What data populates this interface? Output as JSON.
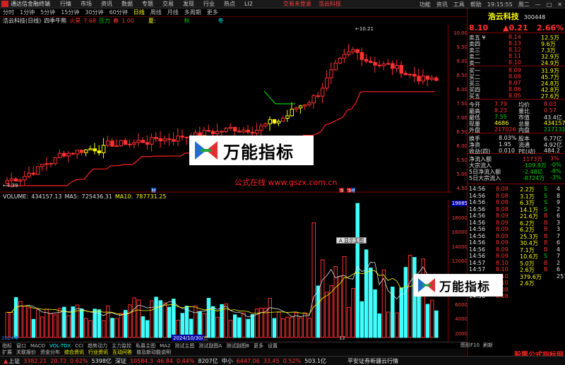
{
  "menubar": {
    "app": "通达信金融终端",
    "items": [
      "行情",
      "市场",
      "资讯",
      "数据",
      "专题",
      "交易",
      "发现",
      "行业",
      "热点",
      "LI2"
    ],
    "center1": "交易未登录",
    "center2": "浩云科技",
    "right": [
      "功能",
      "资讯",
      "工具",
      "帮助"
    ],
    "time": "19:15:55",
    "timeLabel": "周二"
  },
  "toolbar": {
    "items": [
      "分时",
      "1分钟",
      "5分钟",
      "15分钟",
      "30分钟",
      "60分钟",
      "日线",
      "周线",
      "月线",
      "多周期",
      "更多"
    ],
    "active": 6
  },
  "chart": {
    "header": {
      "stock": "浩云科技(日线)",
      "indicator": "四季牛熊",
      "l1": "夏:",
      "l1v": "秋",
      "cold": "冬",
      "hot": "火星",
      "hotv": "7.68",
      "press": "压力",
      "spring": "春",
      "springv": "1.00"
    },
    "yticks": [
      "10.00",
      "9.50",
      "9.00",
      "8.50",
      "8.00",
      "7.50",
      "7.00",
      "6.50",
      "6.00",
      "5.50",
      "5.00",
      "4.50"
    ],
    "hiLabel": "10.21",
    "loLabel": "4.39",
    "cai1": "财",
    "cai2": "财",
    "jin1": "净",
    "jin2": "净"
  },
  "volume": {
    "header": {
      "name": "VOLUME:",
      "vol": "434157.13",
      "ma5lbl": "MA5:",
      "ma5": "725436.31",
      "ma10lbl": "MA10:",
      "ma10": "787731.25"
    },
    "yticks": [
      "19885",
      "18000",
      "16000",
      "14000",
      "12000",
      "10000",
      "8000",
      "6000",
      "4000",
      "2000"
    ],
    "date1": "2024年",
    "date2": "2024/10/30/三",
    "date3": "12",
    "tooltip": "A 显示主图"
  },
  "chart_data": {
    "type": "bar",
    "title": "",
    "categories": [],
    "values": []
  },
  "bottomtabs": [
    "指标",
    "窗口",
    "MACD",
    "VOL-TDX",
    "CCI",
    "趋势动力",
    "主力监控",
    "私募主图",
    "MA2",
    "测试主图",
    "测试副图A",
    "测试副图B",
    "更多",
    "设置"
  ],
  "subtabs": [
    "扩展",
    "关联报价",
    "资金分布",
    "综合资讯",
    "行业资讯",
    "互动问答",
    "普及新动能说明"
  ],
  "rightpanel": {
    "name": "浩云科技",
    "code": "300448",
    "price": "8.10",
    "change": "▲0.21",
    "pct": "2.66%",
    "asks": [
      {
        "l": "卖五 ¥",
        "p": "8.14",
        "v": "12.5万"
      },
      {
        "l": "卖四",
        "p": "8.13",
        "v": "9.6万"
      },
      {
        "l": "卖三",
        "p": "8.12",
        "v": "7.3万"
      },
      {
        "l": "卖二",
        "p": "8.11",
        "v": "32.9万"
      },
      {
        "l": "卖一",
        "p": "8.10",
        "v": "24.9万"
      }
    ],
    "bids": [
      {
        "l": "买一",
        "p": "8.09",
        "v": "31.9万"
      },
      {
        "l": "买二",
        "p": "8.08",
        "v": "45.7万"
      },
      {
        "l": "买三",
        "p": "8.07",
        "v": "24.8万"
      },
      {
        "l": "买四",
        "p": "8.06",
        "v": "42.8万"
      },
      {
        "l": "买五",
        "p": "8.05",
        "v": "27.6万"
      }
    ],
    "stats": [
      [
        "今开",
        "7.79",
        "均价",
        "8.03"
      ],
      [
        "最高",
        "8.23",
        "量比",
        "0.57"
      ],
      [
        "最低",
        "7.55",
        "市值",
        "43.4亿"
      ],
      [
        "现量",
        "4686",
        "总量",
        "434157"
      ],
      [
        "外盘",
        "217026",
        "内盘",
        "217131"
      ]
    ],
    "stats2": [
      [
        "换手",
        "8.03%",
        "股本",
        "6.77亿"
      ],
      [
        "净资",
        "1.95",
        "流通",
        "4.92亿"
      ],
      [
        "收益(四)",
        "0.010",
        "PE(动)",
        "484.2"
      ]
    ],
    "flows": [
      [
        "净流入额",
        "1173万",
        "3%"
      ],
      [
        "大宗流入",
        "-109.8万",
        "-0%"
      ],
      [
        "5日净流入额",
        "-2.48亿",
        "-8%"
      ],
      [
        "5日大宗流入",
        "-8724万",
        "-3%"
      ]
    ],
    "ticks": [
      [
        "14:56",
        "8.08",
        "2.2万",
        "S",
        "4"
      ],
      [
        "14:56",
        "8.08",
        "3.1万",
        "S",
        "8"
      ],
      [
        "14:56",
        "8.08",
        "6.3万",
        "S",
        "9"
      ],
      [
        "14:56",
        "8.08",
        "14.1万",
        "S",
        "2"
      ],
      [
        "14:56",
        "8.09",
        "21.6万",
        "B",
        "6"
      ],
      [
        "14:56",
        "8.09",
        "6.2万",
        "B",
        "3"
      ],
      [
        "14:56",
        "8.09",
        "6.2万",
        "B",
        "3"
      ],
      [
        "14:56",
        "8.09",
        "25.3万",
        "B",
        "7"
      ],
      [
        "14:56",
        "8.09",
        "30.4万",
        "B",
        "6"
      ],
      [
        "14:56",
        "8.09",
        "7.1万",
        "B",
        "4"
      ],
      [
        "14:56",
        "8.09",
        "10.6万",
        "S",
        "7"
      ],
      [
        "14:57",
        "8.10",
        "5.0万",
        "B",
        "2"
      ],
      [
        "14:57",
        "8.10",
        "2.6万",
        "B",
        "6"
      ],
      [
        "15:00",
        "8.10",
        "379.6万",
        "",
        "257"
      ],
      [
        "15:00",
        "8.10",
        "2.6万",
        "",
        ""
      ],
      [
        "14:56",
        "8.08",
        "",
        "",
        ""
      ],
      [
        "14:56",
        "8.08",
        "",
        "",
        ""
      ]
    ],
    "btn1": "图形F10",
    "btn2": "刷新"
  },
  "statusbar": {
    "sh": "上证",
    "shv": "3382.21",
    "shc": "20.72",
    "shp": "0.62%",
    "sha": "5398亿",
    "sz": "深证",
    "szv": "10584.3",
    "szc": "46.84",
    "szp": "0.44%",
    "sza": "8207亿",
    "zx": "中小",
    "zxv": "6447.06",
    "zxc": "33.45",
    "zxp": "0.52%",
    "zxa": "503.1亿",
    "broker": "平安证券新疆云行情"
  },
  "watermark": {
    "text": "万能指标",
    "site": "公式在线 www.gszx.com.cn",
    "corner": "股票公式指标网"
  }
}
